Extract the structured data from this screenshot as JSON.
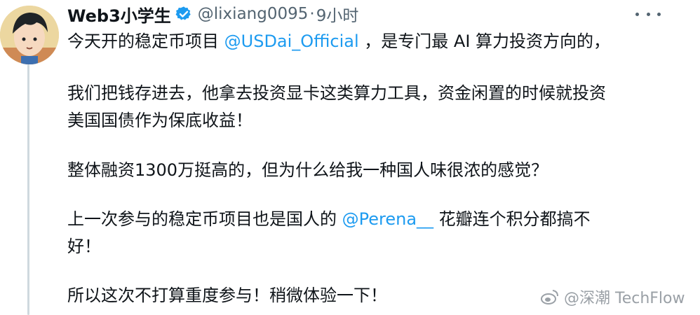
{
  "author": {
    "display_name": "Web3小学生",
    "handle": "@lixiang0095",
    "separator": "·",
    "time": "9小时"
  },
  "icons": {
    "verified": "verified-badge-icon",
    "more": "more-options-icon",
    "watermark_logo": "weibo-logo-icon"
  },
  "colors": {
    "mention": "#1d9bf0",
    "verified": "#1d9bf0",
    "text": "#0f1419",
    "secondary": "#536471"
  },
  "tweet": {
    "line1_a": "今天开的稳定币项目 ",
    "line1_mention": "@USDai_Official",
    "line1_b": " ，是专门最 AI 算力投资方向的，",
    "line2": "我们把钱存进去，他拿去投资显卡这类算力工具，资金闲置的时候就投资",
    "line3": "美国国债作为保底收益！",
    "line4": "整体融资1300万挺高的，但为什么给我一种国人味很浓的感觉？",
    "line5_a": "上一次参与的稳定币项目也是国人的 ",
    "line5_mention": "@Perena__",
    "line5_b": " 花瓣连个积分都搞不",
    "line6": "好！",
    "line7": "所以这次不打算重度参与！稍微体验一下！"
  },
  "watermark": {
    "text": "@深潮 TechFlow"
  }
}
